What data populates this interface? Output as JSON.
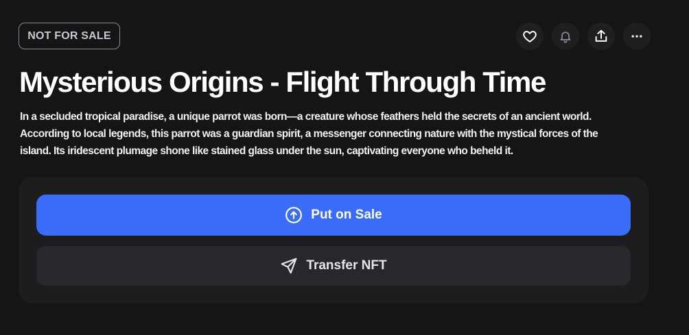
{
  "badge": {
    "label": "NOT FOR SALE"
  },
  "header_actions": [
    {
      "icon": "heart-icon"
    },
    {
      "icon": "bell-icon"
    },
    {
      "icon": "share-icon"
    },
    {
      "icon": "more-icon"
    }
  ],
  "title": "Mysterious Origins - Flight Through Time",
  "description": "In a secluded tropical paradise, a unique parrot was born—a creature whose feathers held the secrets of an ancient world. According to local legends, this parrot was a guardian spirit, a messenger connecting nature with the mystical forces of the island. Its iridescent plumage shone like stained glass under the sun, captivating everyone who beheld it.",
  "actions": {
    "put_on_sale_label": "Put on Sale",
    "transfer_label": "Transfer NFT"
  },
  "colors": {
    "background": "#151517",
    "panel": "#1d1d20",
    "primary_button": "#3a6cf7",
    "secondary_button": "#28282c"
  }
}
